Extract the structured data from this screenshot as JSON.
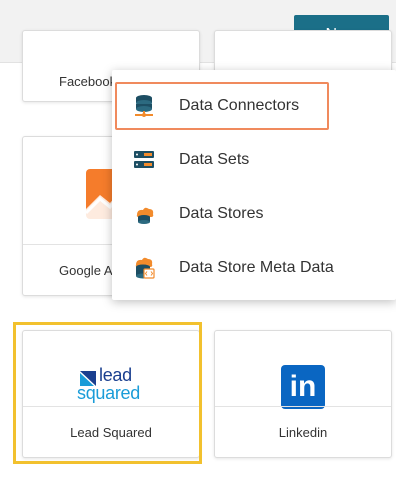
{
  "header": {
    "new_button_label": "New"
  },
  "cards": [
    {
      "label": "Facebook"
    },
    {
      "label": "Google Analytics"
    },
    {
      "label": "Lead Squared",
      "logo_line1": "lead",
      "logo_line2": "squared"
    },
    {
      "label": "Linkedin",
      "logo_text": "in"
    }
  ],
  "menu": {
    "items": [
      {
        "label": "Data Connectors",
        "icon": "database-icon",
        "selected": true
      },
      {
        "label": "Data Sets",
        "icon": "server-icon"
      },
      {
        "label": "Data Stores",
        "icon": "cloud-database-icon"
      },
      {
        "label": "Data Store Meta Data",
        "icon": "code-database-icon"
      }
    ]
  },
  "colors": {
    "primary": "#1b6f88",
    "highlight": "#f2c12e",
    "menu_selected_border": "#f08a5d",
    "icon_teal": "#1d4e63",
    "icon_orange": "#f28b2c",
    "linkedin_blue": "#0a66c2",
    "leadsquared_blue": "#1a9cd8"
  }
}
